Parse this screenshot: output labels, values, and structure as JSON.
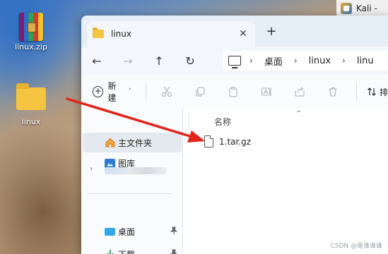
{
  "desktop": {
    "icons": [
      {
        "label": "linux.zip",
        "icon": "winrar-archive-icon"
      },
      {
        "label": "linux",
        "icon": "folder-icon"
      }
    ]
  },
  "taskbar": {
    "kali_label": "Kali -"
  },
  "window": {
    "tab_title": "linux",
    "close_glyph": "✕",
    "newtab_glyph": "+",
    "nav": {
      "back": "←",
      "forward": "→",
      "up": "↑",
      "refresh": "↻"
    },
    "breadcrumbs": [
      "桌面",
      "linux",
      "linu"
    ],
    "breadcrumb_sep": "›",
    "toolbar": {
      "new_label": "新建",
      "new_chevron": "˅",
      "icons": [
        "cut-icon",
        "copy-icon",
        "paste-icon",
        "rename-icon",
        "share-icon",
        "delete-icon"
      ],
      "sort_label": "排"
    },
    "sidebar": {
      "items": [
        {
          "label": "主文件夹",
          "icon": "home-icon"
        },
        {
          "label": "图库",
          "icon": "gallery-icon"
        },
        {
          "label": "桌面",
          "icon": "desktop-icon",
          "pinned": true
        },
        {
          "label": "下载",
          "icon": "download-icon",
          "pinned": true
        }
      ],
      "expander": "›",
      "pin_glyph": "📌"
    },
    "content": {
      "column_name": "名称",
      "sort_caret": "^",
      "files": [
        {
          "name": "1.tar.gz",
          "icon": "file-icon"
        }
      ]
    }
  },
  "watermark": "CSDN @是谁谁谁",
  "colors": {
    "arrow": "#e0241b",
    "folder": "#f5c542",
    "accent": "#2b7cd3"
  }
}
